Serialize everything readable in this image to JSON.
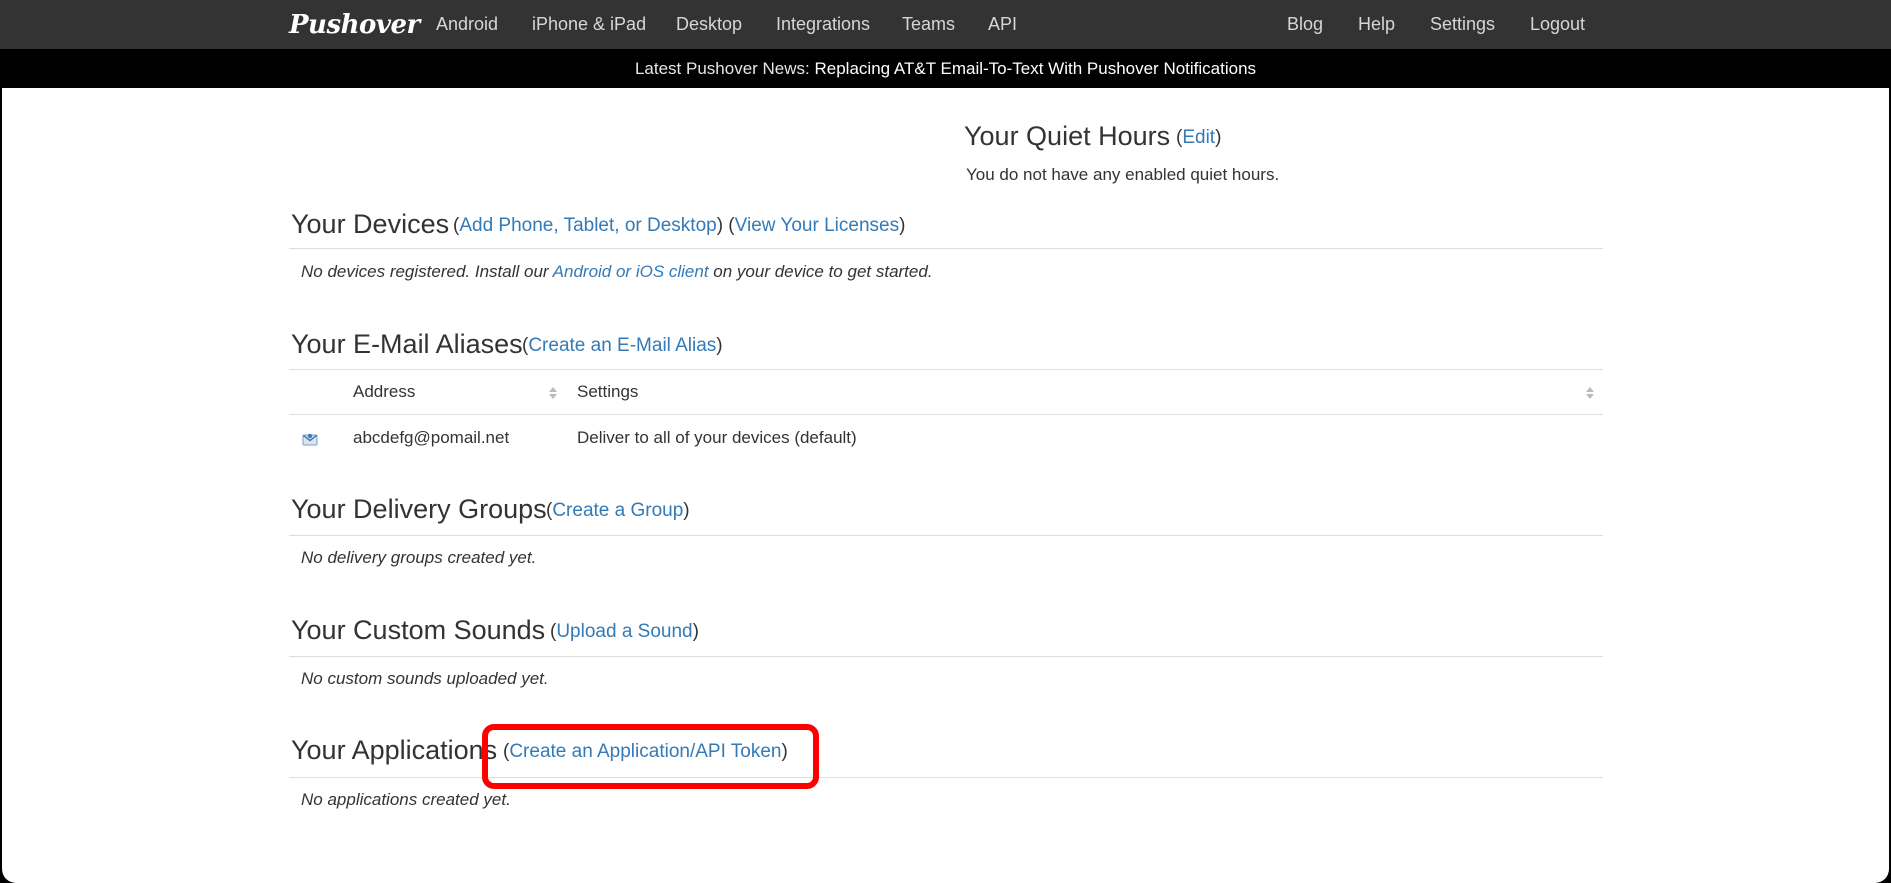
{
  "navbar": {
    "brand": "Pushover",
    "left_links": [
      "Android",
      "iPhone & iPad",
      "Desktop",
      "Integrations",
      "Teams",
      "API"
    ],
    "right_links": [
      "Blog",
      "Help",
      "Settings",
      "Logout"
    ]
  },
  "news": {
    "prefix": "Latest Pushover News:",
    "headline": "Replacing AT&T Email-To-Text With Pushover Notifications"
  },
  "quiet_hours": {
    "title": "Your Quiet Hours",
    "open": "(",
    "edit_label": "Edit",
    "close": ")",
    "text": "You do not have any enabled quiet hours."
  },
  "devices": {
    "title": "Your Devices",
    "add_label": "Add Phone, Tablet, or Desktop",
    "licenses_label": "View Your Licenses",
    "note_before": "No devices registered. Install our",
    "note_link": "Android or iOS client",
    "note_after": "on your device to get started."
  },
  "aliases": {
    "title": "Your E-Mail Aliases",
    "create_label": "Create an E-Mail Alias",
    "columns": [
      "Address",
      "Settings"
    ],
    "rows": [
      {
        "address": "abcdefg@pomail.net",
        "settings": "Deliver to all of your devices (default)",
        "icon": "envelope-icon"
      }
    ]
  },
  "groups": {
    "title": "Your Delivery Groups",
    "create_label": "Create a Group",
    "note": "No delivery groups created yet."
  },
  "sounds": {
    "title": "Your Custom Sounds",
    "upload_label": "Upload a Sound",
    "note": "No custom sounds uploaded yet."
  },
  "applications": {
    "title": "Your Applications",
    "create_label": "Create an Application/API Token",
    "note": "No applications created yet."
  },
  "colors": {
    "navbar": "#333333",
    "newsbar": "#000000",
    "link": "#337ab7",
    "highlight": "#ff0000"
  }
}
